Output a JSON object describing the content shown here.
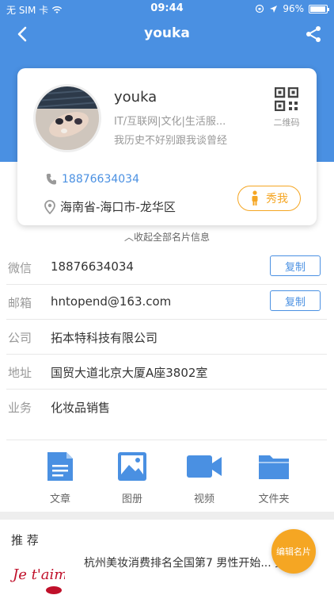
{
  "status_bar": {
    "carrier": "无 SIM 卡",
    "time": "09:44",
    "battery": "96%"
  },
  "nav": {
    "title": "youka"
  },
  "card": {
    "name": "youka",
    "industry": "IT/互联网|文化|生活服...",
    "motto": "我历史不好别跟我谈曾经",
    "qr_label": "二维码",
    "phone": "18876634034",
    "location": "海南省-海口市-龙华区",
    "show_me": "秀我"
  },
  "collapse_label": "收起全部名片信息",
  "info": {
    "wechat_label": "微信",
    "wechat_value": "18876634034",
    "email_label": "邮箱",
    "email_value": "hntopend@163.com",
    "company_label": "公司",
    "company_value": "拓本特科技有限公司",
    "address_label": "地址",
    "address_value": "国贸大道北京大厦A座3802室",
    "business_label": "业务",
    "business_value": "化妆品销售",
    "copy_label": "复制"
  },
  "tools": {
    "article": "文章",
    "album": "图册",
    "video": "视频",
    "folder": "文件夹"
  },
  "recommend": {
    "title": "推 荐",
    "item_text": "杭州美妆消费排名全国第7 男性开始... 买口红",
    "thumb_script": "Je t'aime"
  },
  "edit_button": "编辑名片",
  "colors": {
    "primary": "#4a90e2",
    "accent": "#f5a623"
  },
  "icons": [
    "back-icon",
    "share-icon",
    "qr-code-icon",
    "phone-icon",
    "location-icon",
    "person-icon",
    "chevron-up-icon",
    "document-icon",
    "image-icon",
    "video-icon",
    "folder-icon",
    "wifi-icon"
  ]
}
